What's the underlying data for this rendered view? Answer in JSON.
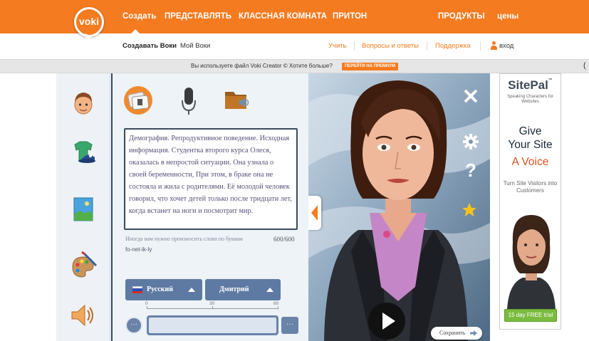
{
  "app": {
    "logo_text": "voki"
  },
  "topnav": {
    "items": [
      {
        "label": "Создать"
      },
      {
        "label": "ПРЕДСТАВЛЯТЬ"
      },
      {
        "label": "КЛАССНАЯ КОМНАТА"
      },
      {
        "label": "ПРИТОН"
      },
      {
        "label": "ПРОДУКТЫ"
      },
      {
        "label": "цены"
      }
    ]
  },
  "subnav": {
    "create_voki": "Создавать Воки",
    "my_voki": "Мой Воки",
    "links": [
      "Учить",
      "Вопросы и ответы",
      "Поддержка"
    ],
    "login": "вход"
  },
  "banner": {
    "text": "Вы используете файл Voki Creator © Хотите больше?",
    "button": "ПЕРЕЙТИ НА ПРЕМИУМ",
    "right_glyph": "("
  },
  "tools": [
    "face-icon",
    "clothing-icon",
    "background-icon",
    "palette-icon",
    "speaker-icon"
  ],
  "editor": {
    "modes": [
      "text-to-speech-icon",
      "microphone-icon",
      "folder-audio-icon"
    ],
    "text": "Демография. Репродуктивное поведение. Исходная информация. Студентка второго курса Олеся, оказалась в непростой ситуации. Она узнала о своей беременности, При этом, в браке она не состояла и жила с родителями. Её молодой человек говорил, что хочет детей только после тридцати лет, когда встанет на ноги и посмотрит мир.",
    "hint": "Иногда вам нужно произносить слова по буквам",
    "counter": "600/600",
    "phonetic": "fo-net-ik-ly",
    "language": "Русский",
    "voice": "Дмитрий",
    "scale": {
      "start": "0",
      "mid": "30",
      "end": "60"
    },
    "more_left": "···",
    "more_right": "···"
  },
  "stage": {
    "icons": [
      "close-icon",
      "gear-icon",
      "help-icon",
      "star-icon"
    ],
    "help_glyph": "?",
    "save_label": "Сохранить"
  },
  "ad": {
    "brand": "SitePal",
    "tm": "™",
    "tagline": "Speaking Characters for Websites",
    "headline1": "Give",
    "headline2": "Your Site",
    "headline3": "A Voice",
    "sub": "Turn Site Visitors into Customers",
    "badge": "15 day FREE trial"
  },
  "colors": {
    "brand_orange": "#f47b20",
    "panel_blue": "#5e7aa3",
    "dark_navy": "#32475f"
  }
}
